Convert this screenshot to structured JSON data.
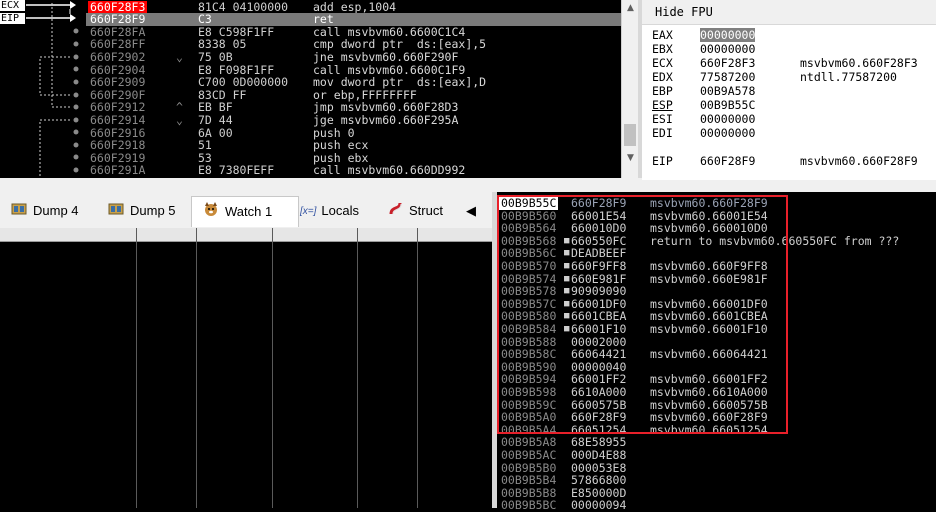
{
  "disassembly": {
    "rows": [
      {
        "addr": "660F28F3",
        "sym": "",
        "bytes": "81C4 04100000",
        "instr": "add esp,1004",
        "state": "cur"
      },
      {
        "addr": "660F28F9",
        "sym": "",
        "bytes": "C3",
        "instr": "ret",
        "state": "sel"
      },
      {
        "addr": "660F28FA",
        "sym": "",
        "bytes": "E8 C598F1FF",
        "instr": "call msvbvm60.6600C1C4",
        "state": ""
      },
      {
        "addr": "660F28FF",
        "sym": "",
        "bytes": "8338 05",
        "instr": "cmp dword ptr  ds:[eax],5",
        "state": ""
      },
      {
        "addr": "660F2902",
        "sym": "⌄",
        "bytes": "75 0B",
        "instr": "jne msvbvm60.660F290F",
        "state": ""
      },
      {
        "addr": "660F2904",
        "sym": "",
        "bytes": "E8 F098F1FF",
        "instr": "call msvbvm60.6600C1F9",
        "state": ""
      },
      {
        "addr": "660F2909",
        "sym": "",
        "bytes": "C700 0D000000",
        "instr": "mov dword ptr  ds:[eax],D",
        "state": ""
      },
      {
        "addr": "660F290F",
        "sym": "",
        "bytes": "83CD FF",
        "instr": "or ebp,FFFFFFFF",
        "state": ""
      },
      {
        "addr": "660F2912",
        "sym": "^",
        "bytes": "EB BF",
        "instr": "jmp msvbvm60.660F28D3",
        "state": ""
      },
      {
        "addr": "660F2914",
        "sym": "⌄",
        "bytes": "7D 44",
        "instr": "jge msvbvm60.660F295A",
        "state": ""
      },
      {
        "addr": "660F2916",
        "sym": "",
        "bytes": "6A 00",
        "instr": "push 0",
        "state": ""
      },
      {
        "addr": "660F2918",
        "sym": "",
        "bytes": "51",
        "instr": "push ecx",
        "state": ""
      },
      {
        "addr": "660F2919",
        "sym": "",
        "bytes": "53",
        "instr": "push ebx",
        "state": ""
      },
      {
        "addr": "660F291A",
        "sym": "",
        "bytes": "E8 7380FEFF",
        "instr": "call msvbvm60.660DD992",
        "state": ""
      }
    ],
    "reg_labels": [
      "ECX",
      "EIP"
    ]
  },
  "registers": {
    "header": "Hide FPU",
    "rows": [
      {
        "name": "EAX",
        "value": "00000000",
        "sym": "",
        "hl": true,
        "ul": false
      },
      {
        "name": "EBX",
        "value": "00000000",
        "sym": "",
        "hl": false,
        "ul": false
      },
      {
        "name": "ECX",
        "value": "660F28F3",
        "sym": "msvbvm60.660F28F3",
        "hl": false,
        "ul": false
      },
      {
        "name": "EDX",
        "value": "77587200",
        "sym": "ntdll.77587200",
        "hl": false,
        "ul": false
      },
      {
        "name": "EBP",
        "value": "00B9A578",
        "sym": "",
        "hl": false,
        "ul": false
      },
      {
        "name": "ESP",
        "value": "00B9B55C",
        "sym": "",
        "hl": false,
        "ul": true
      },
      {
        "name": "ESI",
        "value": "00000000",
        "sym": "",
        "hl": false,
        "ul": false
      },
      {
        "name": "EDI",
        "value": "00000000",
        "sym": "",
        "hl": false,
        "ul": false
      },
      {
        "name": "EIP",
        "value": "660F28F9",
        "sym": "msvbvm60.660F28F9",
        "hl": false,
        "ul": false
      }
    ]
  },
  "tabs": [
    {
      "label": "Dump 4",
      "icon": "memory-chip-icon"
    },
    {
      "label": "Dump 5",
      "icon": "memory-chip-icon"
    },
    {
      "label": "Watch 1",
      "icon": "watch-dog-icon",
      "active": true
    },
    {
      "label": "Locals",
      "icon": "variable-icon"
    },
    {
      "label": "Struct",
      "icon": "struct-icon"
    }
  ],
  "tab_scroll": {
    "left": "◀"
  },
  "stack": {
    "rows": [
      {
        "addr": "00B9B55C",
        "mark": "",
        "val": "660F28F9",
        "com": "msvbvm60.660F28F9",
        "top": true
      },
      {
        "addr": "00B9B560",
        "mark": "",
        "val": "66001E54",
        "com": "msvbvm60.66001E54"
      },
      {
        "addr": "00B9B564",
        "mark": "",
        "val": "660010D0",
        "com": "msvbvm60.660010D0"
      },
      {
        "addr": "00B9B568",
        "mark": "■",
        "val": "660550FC",
        "com": "return to msvbvm60.660550FC from ???"
      },
      {
        "addr": "00B9B56C",
        "mark": "■",
        "val": "DEADBEEF",
        "com": ""
      },
      {
        "addr": "00B9B570",
        "mark": "■",
        "val": "660F9FF8",
        "com": "msvbvm60.660F9FF8"
      },
      {
        "addr": "00B9B574",
        "mark": "■",
        "val": "660E981F",
        "com": "msvbvm60.660E981F"
      },
      {
        "addr": "00B9B578",
        "mark": "■",
        "val": "90909090",
        "com": ""
      },
      {
        "addr": "00B9B57C",
        "mark": "■",
        "val": "66001DF0",
        "com": "msvbvm60.66001DF0"
      },
      {
        "addr": "00B9B580",
        "mark": "■",
        "val": "6601CBEA",
        "com": "msvbvm60.6601CBEA"
      },
      {
        "addr": "00B9B584",
        "mark": "■",
        "val": "66001F10",
        "com": "msvbvm60.66001F10"
      },
      {
        "addr": "00B9B588",
        "mark": "",
        "val": "00002000",
        "com": ""
      },
      {
        "addr": "00B9B58C",
        "mark": "",
        "val": "66064421",
        "com": "msvbvm60.66064421"
      },
      {
        "addr": "00B9B590",
        "mark": "",
        "val": "00000040",
        "com": ""
      },
      {
        "addr": "00B9B594",
        "mark": "",
        "val": "66001FF2",
        "com": "msvbvm60.66001FF2"
      },
      {
        "addr": "00B9B598",
        "mark": "",
        "val": "6610A000",
        "com": "msvbvm60.6610A000"
      },
      {
        "addr": "00B9B59C",
        "mark": "",
        "val": "6600575B",
        "com": "msvbvm60.6600575B"
      },
      {
        "addr": "00B9B5A0",
        "mark": "",
        "val": "660F28F9",
        "com": "msvbvm60.660F28F9"
      },
      {
        "addr": "00B9B5A4",
        "mark": "",
        "val": "66051254",
        "com": "msvbvm60.66051254"
      },
      {
        "addr": "00B9B5A8",
        "mark": "",
        "val": "68E58955",
        "com": ""
      },
      {
        "addr": "00B9B5AC",
        "mark": "",
        "val": "000D4E88",
        "com": ""
      },
      {
        "addr": "00B9B5B0",
        "mark": "",
        "val": "000053E8",
        "com": ""
      },
      {
        "addr": "00B9B5B4",
        "mark": "",
        "val": "57866800",
        "com": ""
      },
      {
        "addr": "00B9B5B8",
        "mark": "",
        "val": "E850000D",
        "com": ""
      },
      {
        "addr": "00B9B5BC",
        "mark": "",
        "val": "00000094",
        "com": ""
      }
    ]
  },
  "colors": {
    "current_ip": "#ff0000",
    "highlight_box": "#e8202a",
    "selection": "#7a7a7a"
  }
}
